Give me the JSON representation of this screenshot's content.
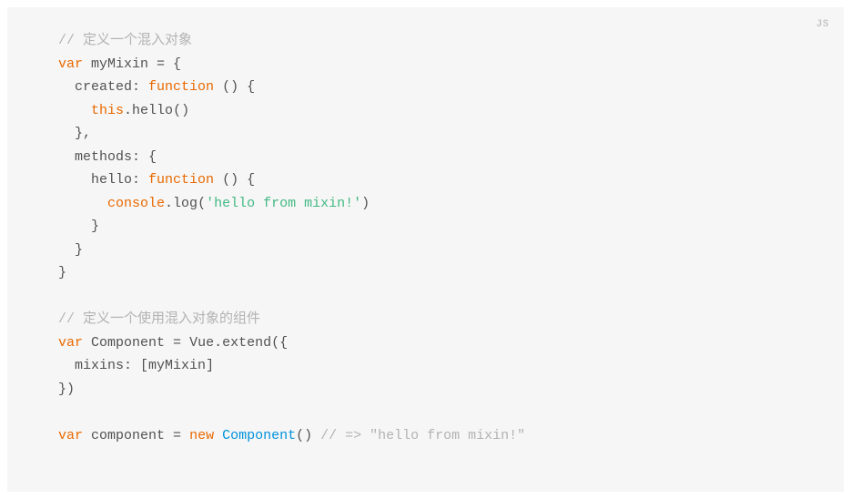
{
  "langLabel": "JS",
  "tokens": [
    [
      {
        "cls": "tk-comment",
        "t": "// 定义一个混入对象"
      }
    ],
    [
      {
        "cls": "tk-keyword",
        "t": "var"
      },
      {
        "cls": "tk-plain",
        "t": " myMixin "
      },
      {
        "cls": "tk-punct",
        "t": "= {"
      }
    ],
    [
      {
        "cls": "tk-plain",
        "t": "  created: "
      },
      {
        "cls": "tk-keyword",
        "t": "function"
      },
      {
        "cls": "tk-plain",
        "t": " "
      },
      {
        "cls": "tk-punct",
        "t": "() {"
      }
    ],
    [
      {
        "cls": "tk-plain",
        "t": "    "
      },
      {
        "cls": "tk-builtin",
        "t": "this"
      },
      {
        "cls": "tk-punct",
        "t": "."
      },
      {
        "cls": "tk-plain",
        "t": "hello"
      },
      {
        "cls": "tk-punct",
        "t": "()"
      }
    ],
    [
      {
        "cls": "tk-punct",
        "t": "  },"
      }
    ],
    [
      {
        "cls": "tk-plain",
        "t": "  methods"
      },
      {
        "cls": "tk-punct",
        "t": ": {"
      }
    ],
    [
      {
        "cls": "tk-plain",
        "t": "    hello: "
      },
      {
        "cls": "tk-keyword",
        "t": "function"
      },
      {
        "cls": "tk-plain",
        "t": " "
      },
      {
        "cls": "tk-punct",
        "t": "() {"
      }
    ],
    [
      {
        "cls": "tk-plain",
        "t": "      "
      },
      {
        "cls": "tk-builtin",
        "t": "console"
      },
      {
        "cls": "tk-punct",
        "t": "."
      },
      {
        "cls": "tk-plain",
        "t": "log"
      },
      {
        "cls": "tk-punct",
        "t": "("
      },
      {
        "cls": "tk-string",
        "t": "'hello from mixin!'"
      },
      {
        "cls": "tk-punct",
        "t": ")"
      }
    ],
    [
      {
        "cls": "tk-punct",
        "t": "    }"
      }
    ],
    [
      {
        "cls": "tk-punct",
        "t": "  }"
      }
    ],
    [
      {
        "cls": "tk-punct",
        "t": "}"
      }
    ],
    [],
    [
      {
        "cls": "tk-comment",
        "t": "// 定义一个使用混入对象的组件"
      }
    ],
    [
      {
        "cls": "tk-keyword",
        "t": "var"
      },
      {
        "cls": "tk-plain",
        "t": " Component "
      },
      {
        "cls": "tk-punct",
        "t": "= "
      },
      {
        "cls": "tk-plain",
        "t": "Vue"
      },
      {
        "cls": "tk-punct",
        "t": "."
      },
      {
        "cls": "tk-plain",
        "t": "extend"
      },
      {
        "cls": "tk-punct",
        "t": "({"
      }
    ],
    [
      {
        "cls": "tk-plain",
        "t": "  mixins"
      },
      {
        "cls": "tk-punct",
        "t": ": ["
      },
      {
        "cls": "tk-plain",
        "t": "myMixin"
      },
      {
        "cls": "tk-punct",
        "t": "]"
      }
    ],
    [
      {
        "cls": "tk-punct",
        "t": "})"
      }
    ],
    [],
    [
      {
        "cls": "tk-keyword",
        "t": "var"
      },
      {
        "cls": "tk-plain",
        "t": " component "
      },
      {
        "cls": "tk-punct",
        "t": "= "
      },
      {
        "cls": "tk-keyword",
        "t": "new"
      },
      {
        "cls": "tk-plain",
        "t": " "
      },
      {
        "cls": "tk-function",
        "t": "Component"
      },
      {
        "cls": "tk-punct",
        "t": "() "
      },
      {
        "cls": "tk-comment",
        "t": "// => \"hello from mixin!\""
      }
    ]
  ]
}
